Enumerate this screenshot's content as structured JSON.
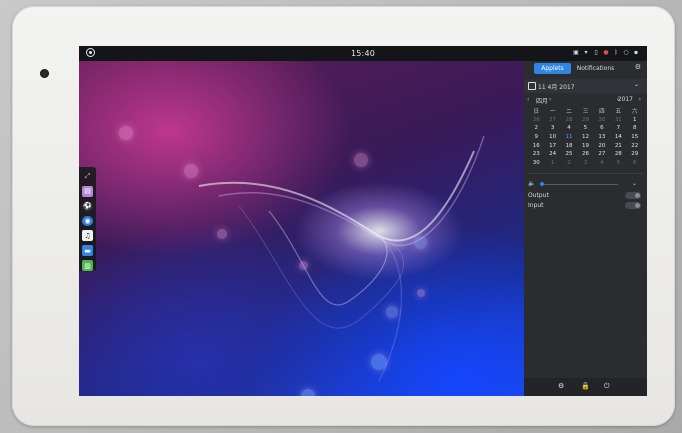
{
  "topbar": {
    "time": "15:40",
    "tray_icons": [
      "camera-icon",
      "wifi-icon",
      "battery-icon",
      "record-icon",
      "bluetooth-icon",
      "power-icon",
      "display-icon"
    ]
  },
  "dock": {
    "items": [
      "expand-icon",
      "files-icon",
      "media-icon",
      "browser-icon",
      "music-icon",
      "folder-icon",
      "terminal-icon"
    ]
  },
  "panel": {
    "tabs": {
      "applets": "Applets",
      "notifications": "Notifications"
    },
    "date": "11 4月 2017",
    "calendar": {
      "month": "四月",
      "year": "2017",
      "weekdays": [
        "日",
        "一",
        "二",
        "三",
        "四",
        "五",
        "六"
      ],
      "weeks": [
        [
          "26",
          "27",
          "28",
          "29",
          "30",
          "31",
          "1"
        ],
        [
          "2",
          "3",
          "4",
          "5",
          "6",
          "7",
          "8"
        ],
        [
          "9",
          "10",
          "11",
          "12",
          "13",
          "14",
          "15"
        ],
        [
          "16",
          "17",
          "18",
          "19",
          "20",
          "21",
          "22"
        ],
        [
          "23",
          "24",
          "25",
          "26",
          "27",
          "28",
          "29"
        ],
        [
          "30",
          "1",
          "2",
          "3",
          "4",
          "5",
          "6"
        ]
      ],
      "today": "11"
    },
    "sound": {
      "output_label": "Output",
      "input_label": "Input"
    }
  },
  "colors": {
    "accent": "#2f86e6",
    "panel_bg": "#2b2c30",
    "topbar_bg": "#141519"
  }
}
